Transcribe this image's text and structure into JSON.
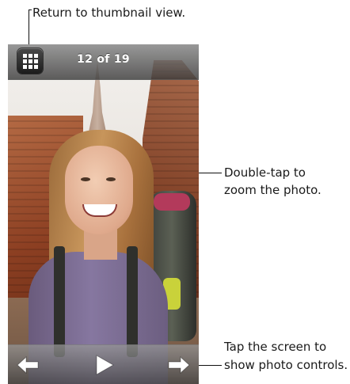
{
  "callouts": {
    "thumbnail": "Return to thumbnail view.",
    "zoom_line1": "Double-tap to",
    "zoom_line2": "zoom the photo.",
    "controls_line1": "Tap the screen to",
    "controls_line2": "show photo controls."
  },
  "viewer": {
    "counter": "12 of 19",
    "icons": {
      "thumbnail_button": "grid-icon",
      "previous": "arrow-left-icon",
      "play": "play-icon",
      "next": "arrow-right-icon"
    }
  }
}
